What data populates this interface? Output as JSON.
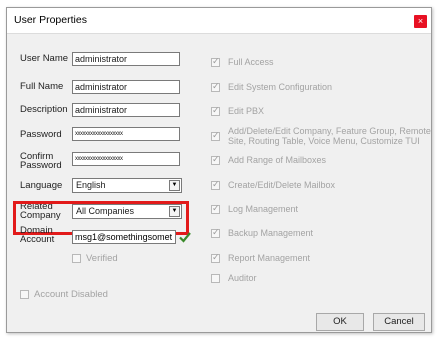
{
  "window": {
    "title": "User Properties",
    "close_icon": "×"
  },
  "form": {
    "user_name_label": "User Name",
    "user_name_value": "administrator",
    "full_name_label": "Full Name",
    "full_name_value": "administrator",
    "description_label": "Description",
    "description_value": "administrator",
    "password_label": "Password",
    "password_value": "xxxxxxxxxxxxxxxxxxx",
    "confirm_password_label_line1": "Confirm",
    "confirm_password_label_line2": "Password",
    "confirm_password_value": "xxxxxxxxxxxxxxxxxxx",
    "language_label": "Language",
    "language_value": "English",
    "related_company_label_line1": "Related",
    "related_company_label_line2": "Company",
    "related_company_value": "All Companies",
    "domain_account_label_line1": "Domain",
    "domain_account_label_line2": "Account",
    "domain_account_value": "msg1@somethingsomet",
    "verified_label": "Verified",
    "account_disabled_label": "Account Disabled"
  },
  "permissions": [
    {
      "label": "Full Access",
      "checked": true
    },
    {
      "label": "Edit System Configuration",
      "checked": true
    },
    {
      "label": "Edit PBX",
      "checked": true
    },
    {
      "label": "Add/Delete/Edit Company, Feature Group, Remote",
      "label2": "Site, Routing Table, Voice Menu, Customize TUI",
      "checked": true
    },
    {
      "label": "Add Range of Mailboxes",
      "checked": true
    },
    {
      "label": "Create/Edit/Delete Mailbox",
      "checked": true
    },
    {
      "label": "Log Management",
      "checked": true
    },
    {
      "label": "Backup Management",
      "checked": true
    },
    {
      "label": "Report Management",
      "checked": true
    },
    {
      "label": "Auditor",
      "checked": false
    }
  ],
  "buttons": {
    "ok_label": "OK",
    "cancel_label": "Cancel"
  },
  "colors": {
    "highlight": "#e21a1a",
    "close": "#e81123",
    "verified_check": "#3a8a2a"
  }
}
